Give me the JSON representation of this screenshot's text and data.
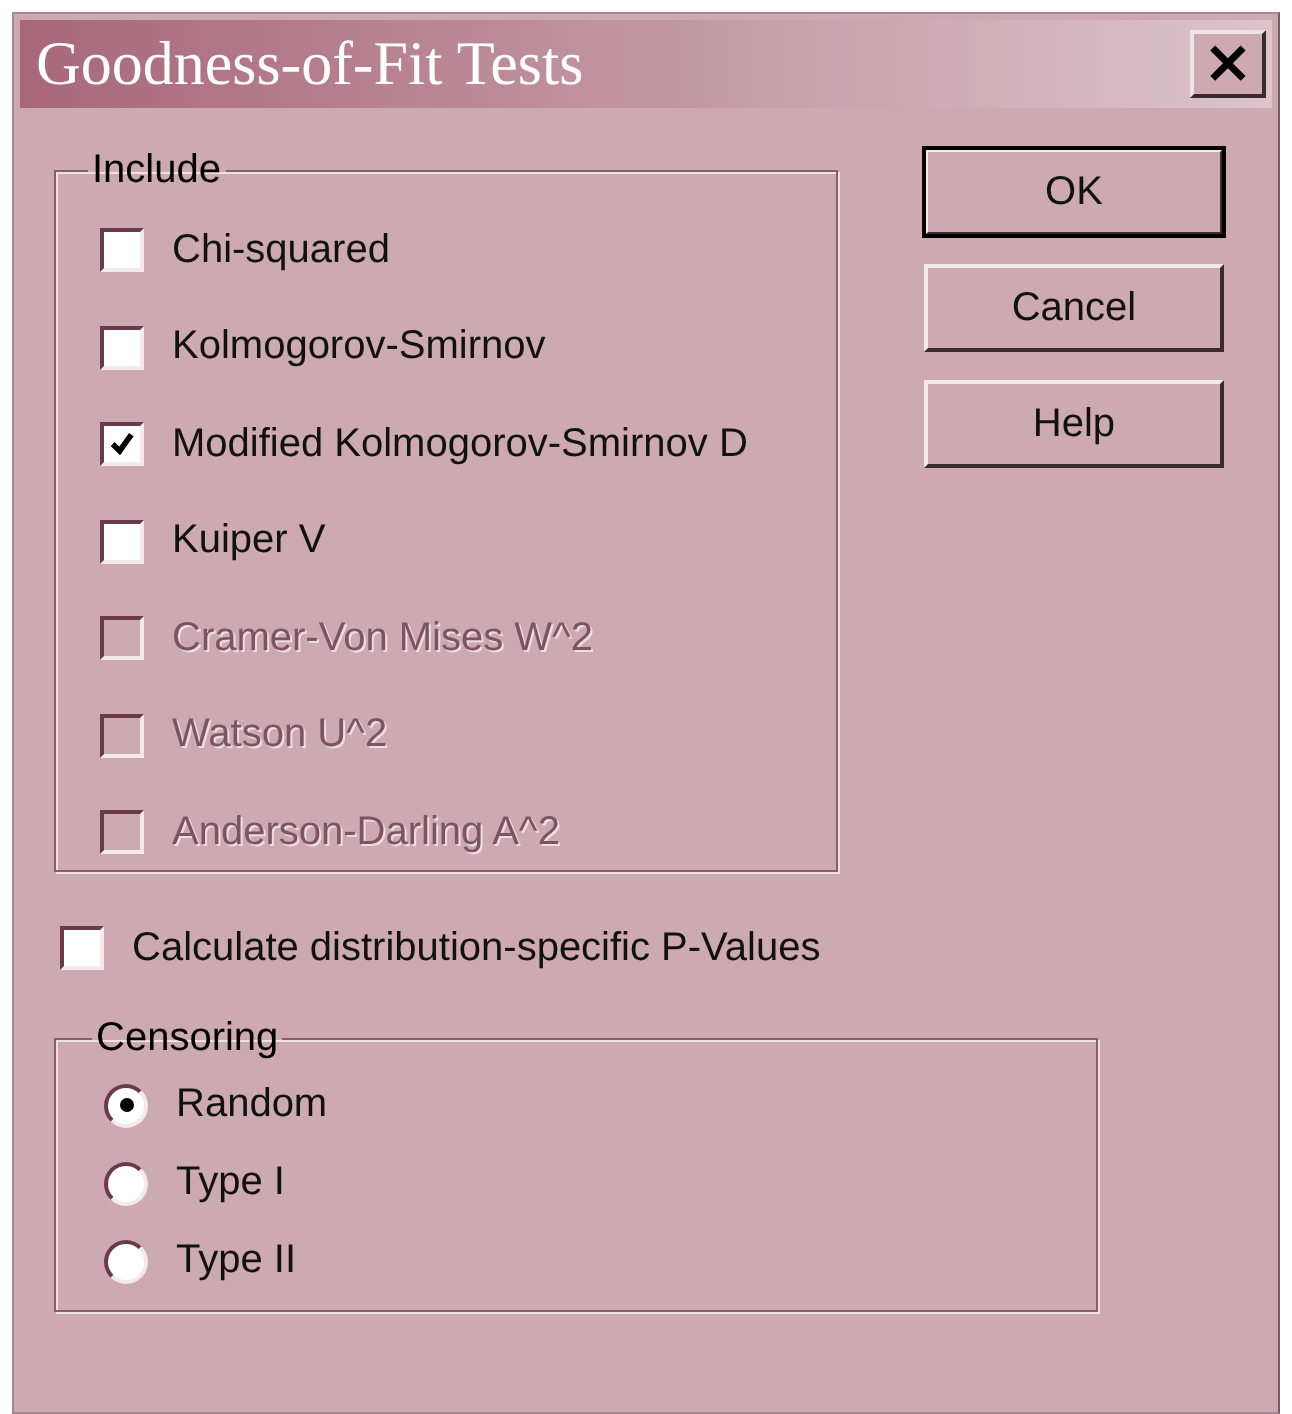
{
  "window": {
    "title": "Goodness-of-Fit Tests",
    "close": "×"
  },
  "include": {
    "label": "Include",
    "items": [
      {
        "label": "Chi-squared",
        "checked": false,
        "disabled": false
      },
      {
        "label": "Kolmogorov-Smirnov",
        "checked": false,
        "disabled": false
      },
      {
        "label": "Modified Kolmogorov-Smirnov D",
        "checked": true,
        "disabled": false
      },
      {
        "label": "Kuiper V",
        "checked": false,
        "disabled": false
      },
      {
        "label": "Cramer-Von Mises W^2",
        "checked": false,
        "disabled": true
      },
      {
        "label": "Watson U^2",
        "checked": false,
        "disabled": true
      },
      {
        "label": "Anderson-Darling A^2",
        "checked": false,
        "disabled": true
      }
    ]
  },
  "p_values": {
    "label": "Calculate distribution-specific P-Values",
    "checked": false
  },
  "censoring": {
    "label": "Censoring",
    "options": [
      {
        "label": "Random",
        "selected": true
      },
      {
        "label": "Type I",
        "selected": false
      },
      {
        "label": "Type II",
        "selected": false
      }
    ]
  },
  "buttons": [
    {
      "label": "OK",
      "default": true
    },
    {
      "label": "Cancel",
      "default": false
    },
    {
      "label": "Help",
      "default": false
    }
  ]
}
